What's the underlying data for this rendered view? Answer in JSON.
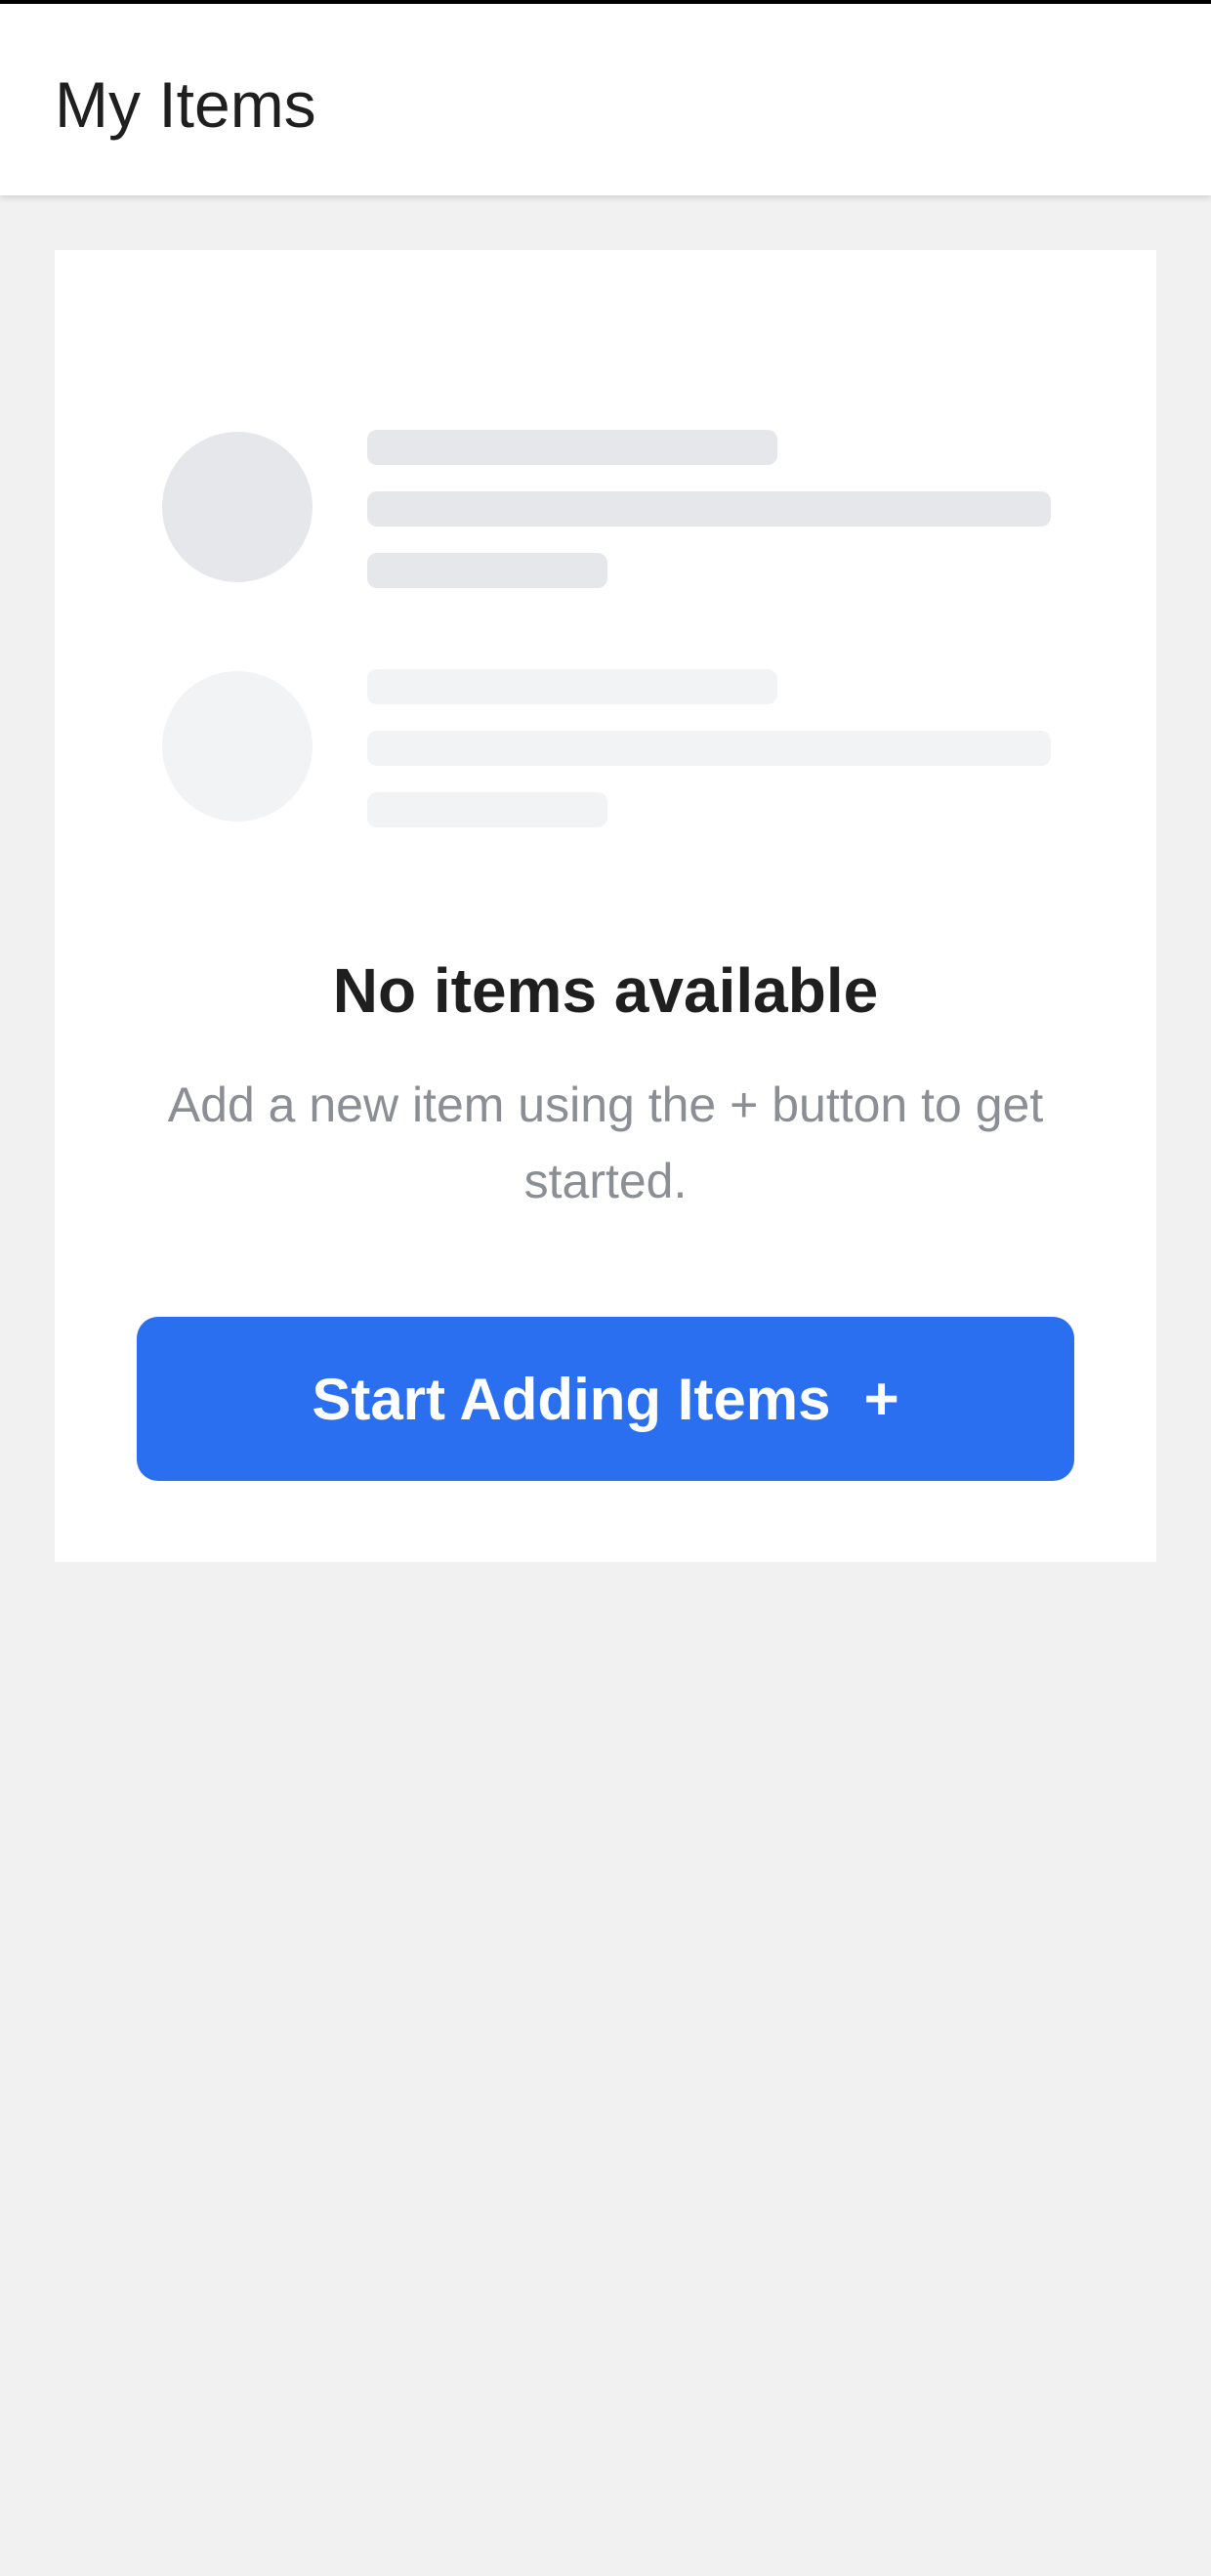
{
  "app_bar": {
    "title": "My Items"
  },
  "empty_state": {
    "title": "No items available",
    "description": "Add a new item using the + button to get started.",
    "button_label": "Start Adding Items",
    "button_icon": "+"
  },
  "colors": {
    "accent": "#2a6ff0",
    "background": "#f1f1f2",
    "skeleton": "#e6e7ea",
    "skeleton_faded": "#f2f3f5",
    "title_text": "#1f1f1f",
    "muted_text": "#8b8e94"
  }
}
